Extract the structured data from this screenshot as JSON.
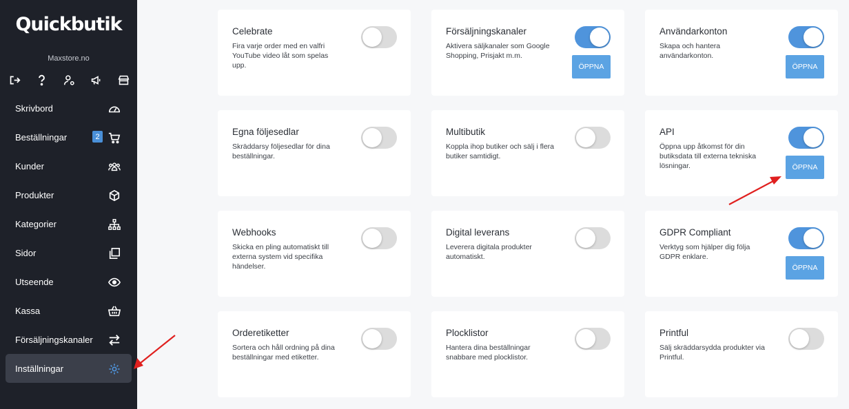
{
  "sidebar": {
    "logo": "Quickbutik",
    "store": "Maxstore.no",
    "quick_icons": [
      "logout-icon",
      "help-icon",
      "user-settings-icon",
      "megaphone-icon",
      "storefront-icon"
    ],
    "items": [
      {
        "label": "Skrivbord",
        "icon": "dashboard-icon"
      },
      {
        "label": "Beställningar",
        "icon": "cart-icon",
        "badge": "2"
      },
      {
        "label": "Kunder",
        "icon": "users-icon"
      },
      {
        "label": "Produkter",
        "icon": "box-icon"
      },
      {
        "label": "Kategorier",
        "icon": "sitemap-icon"
      },
      {
        "label": "Sidor",
        "icon": "pages-icon"
      },
      {
        "label": "Utseende",
        "icon": "eye-icon"
      },
      {
        "label": "Kassa",
        "icon": "basket-icon"
      },
      {
        "label": "Försäljningskanaler",
        "icon": "exchange-icon"
      },
      {
        "label": "Inställningar",
        "icon": "gear-icon",
        "active": true
      }
    ]
  },
  "apps": [
    {
      "title": "Celebrate",
      "desc": "Fira varje order med en valfri YouTube video låt som spelas upp.",
      "enabled": false
    },
    {
      "title": "Försäljningskanaler",
      "desc": "Aktivera säljkanaler som Google Shopping, Prisjakt m.m.",
      "enabled": true,
      "button": "ÖPPNA"
    },
    {
      "title": "Användarkonton",
      "desc": "Skapa och hantera användarkonton.",
      "enabled": true,
      "button": "ÖPPNA"
    },
    {
      "title": "Egna följesedlar",
      "desc": "Skräddarsy följesedlar för dina beställningar.",
      "enabled": false
    },
    {
      "title": "Multibutik",
      "desc": "Koppla ihop butiker och sälj i flera butiker samtidigt.",
      "enabled": false
    },
    {
      "title": "API",
      "desc": "Öppna upp åtkomst för din butiksdata till externa tekniska lösningar.",
      "enabled": true,
      "button": "ÖPPNA"
    },
    {
      "title": "Webhooks",
      "desc": "Skicka en pling automatiskt till externa system vid specifika händelser.",
      "enabled": false
    },
    {
      "title": "Digital leverans",
      "desc": "Leverera digitala produkter automatiskt.",
      "enabled": false
    },
    {
      "title": "GDPR Compliant",
      "desc": "Verktyg som hjälper dig följa GDPR enklare.",
      "enabled": true,
      "button": "ÖPPNA"
    },
    {
      "title": "Orderetiketter",
      "desc": "Sortera och håll ordning på dina beställningar med etiketter.",
      "enabled": false
    },
    {
      "title": "Plocklistor",
      "desc": "Hantera dina beställningar snabbare med plocklistor.",
      "enabled": false
    },
    {
      "title": "Printful",
      "desc": "Sälj skräddarsydda produkter via Printful.",
      "enabled": false
    }
  ],
  "colors": {
    "sidebar": "#1e2129",
    "accent": "#4f94dc",
    "button": "#5ba3e3",
    "annotation": "#e0201f"
  }
}
